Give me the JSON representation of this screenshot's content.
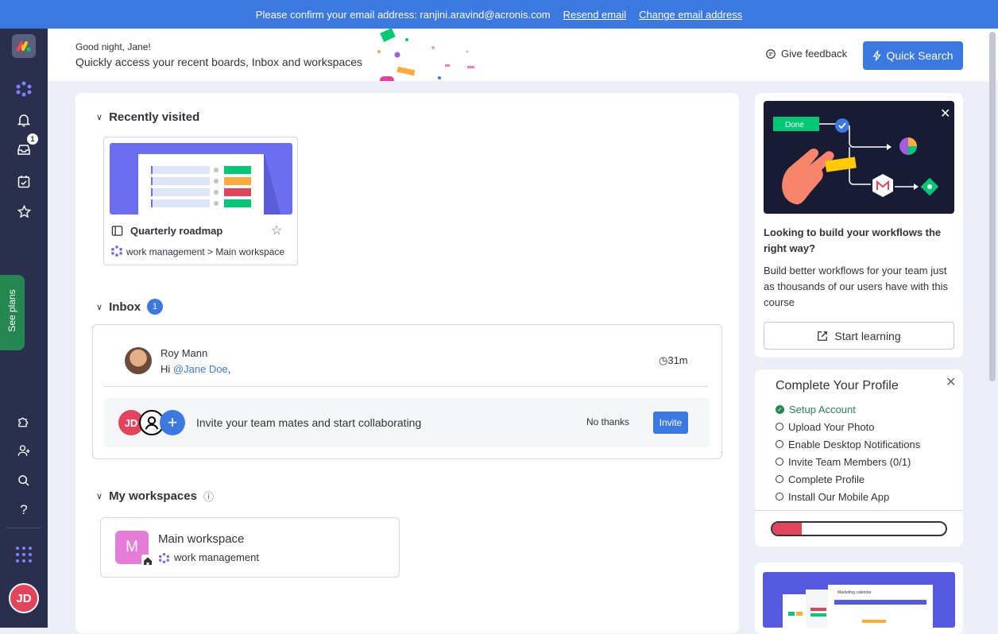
{
  "banner": {
    "text": "Please confirm your email address: ranjini.aravind@acronis.com",
    "resend": "Resend email",
    "change": "Change email address"
  },
  "rail": {
    "inbox_badge": "1",
    "see_plans": "See plans",
    "avatar_initials": "JD",
    "icons": [
      "monday-logo",
      "workspace-icon",
      "bell-icon",
      "inbox-icon",
      "my-work-icon",
      "favorites-icon",
      "integrations-icon",
      "invite-member-icon",
      "search-icon",
      "help-icon",
      "apps-grid-icon"
    ]
  },
  "header": {
    "greeting": "Good night, Jane!",
    "subtitle": "Quickly access your recent boards, Inbox and workspaces",
    "feedback": "Give feedback",
    "quick_search": "Quick Search"
  },
  "recent": {
    "title": "Recently visited",
    "board": {
      "name": "Quarterly roadmap",
      "path": "work management > Main workspace"
    }
  },
  "inbox": {
    "title": "Inbox",
    "count": "1",
    "item": {
      "author": "Roy Mann",
      "greeting": "Hi",
      "mention": "@Jane Doe",
      "suffix": ",",
      "time": "31m"
    },
    "invite": {
      "avatar_initials": "JD",
      "text": "Invite your team mates and start collaborating",
      "no_thanks": "No thanks",
      "invite": "Invite"
    }
  },
  "workspaces": {
    "title": "My workspaces",
    "item": {
      "letter": "M",
      "name": "Main workspace",
      "product": "work management"
    }
  },
  "promo": {
    "done_label": "Done",
    "title": "Looking to build your workflows the right way?",
    "text": "Build better workflows for your team just as thousands of our users have with this course",
    "button": "Start learning"
  },
  "profile": {
    "title": "Complete Your Profile",
    "items": [
      {
        "label": "Setup Account",
        "done": true
      },
      {
        "label": "Upload Your Photo",
        "done": false
      },
      {
        "label": "Enable Desktop Notifications",
        "done": false
      },
      {
        "label": "Invite Team Members (0/1)",
        "done": false
      },
      {
        "label": "Complete Profile",
        "done": false
      },
      {
        "label": "Install Our Mobile App",
        "done": false
      }
    ],
    "progress": 0.17
  },
  "card3": {
    "caption": "Marketing calendar"
  },
  "colors": {
    "primary": "#3b78e0",
    "rail": "#292f4c",
    "green": "#258750",
    "red": "#e2445c"
  }
}
